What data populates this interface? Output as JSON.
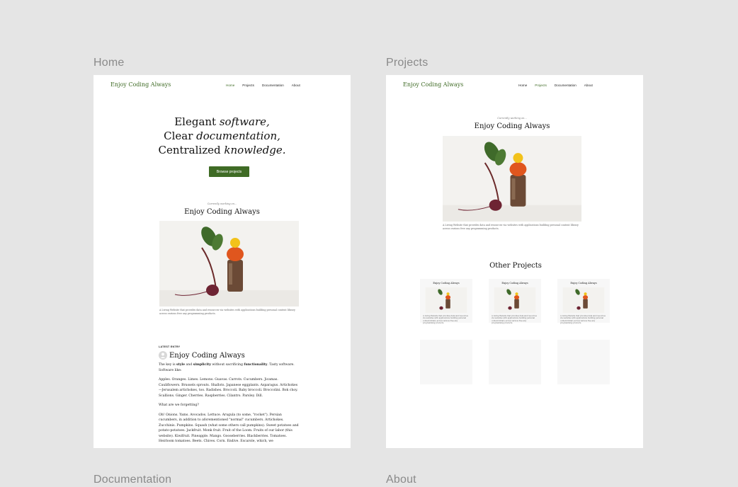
{
  "frames": {
    "home": {
      "label": "Home"
    },
    "projects": {
      "label": "Projects"
    },
    "documentation": {
      "label": "Documentation"
    },
    "about": {
      "label": "About"
    }
  },
  "site": {
    "logo": "Enjoy Coding Always",
    "nav": [
      "Home",
      "Projects",
      "Documentation",
      "About"
    ],
    "accent": "#3f6b25"
  },
  "home": {
    "hero_line1_a": "Elegant ",
    "hero_line1_b": "software,",
    "hero_line2_a": "Clear ",
    "hero_line2_b": "documentation,",
    "hero_line3_a": "Centralized ",
    "hero_line3_b": "knowledge.",
    "cta": "Browse projects",
    "featured_kicker": "Currently working on...",
    "featured_title": "Enjoy Coding Always",
    "featured_caption": "A Living Website that provides data and resources via websites with applications building personal content library across various free any programming products.",
    "latest_label": "LATEST ENTRY",
    "entry_title": "Enjoy Coding Always",
    "entry_p1_a": "The key is ",
    "entry_p1_b": "style",
    "entry_p1_c": " and ",
    "entry_p1_d": "simplicity",
    "entry_p1_e": " without sacrificing ",
    "entry_p1_f": "functionality",
    "entry_p1_g": ". Tasty software. Software like:",
    "entry_p2": "Apples. Oranges. Limes. Lemons. Guavas. Carrots. Cucumbers. Jicamas. Cauliflowers. Brussels sprouts. Shallots. Japanese eggplants. Asparagus. Artichokes—Jerusalem artichokes, too. Radishes. Broccoli. Baby broccoli. Broccolini. Bok choy. Scallions. Ginger. Cherries. Raspberries. Cilantro. Parsley. Dill.",
    "entry_p3": "What are we forgetting?",
    "entry_p4": "Oh! Onions. Yams. Avocados. Lettuce. Arugula (to some, \"rocket\"). Persian cucumbers, in addition to aforementioned \"normal\" cucumbers. Artichokes. Zucchinis. Pumpkins. Squash (what some others call pumpkins). Sweet potatoes and potato-potatoes. Jackfruit. Monk fruit. Fruit of the Loom. Fruits of our labor (this website). Kiwifruit. Pineapple. Mango. Gooseberries. Blackberries. Tomatoes. Heirloom tomatoes. Beets. Chives. Corn. Endive. Escarole, which, we"
  },
  "projects": {
    "kicker": "Currently working on...",
    "title": "Enjoy Coding Always",
    "caption": "A Living Website that provides data and resources via websites with applications building personal content library across various free any programming products.",
    "other_title": "Other Projects",
    "cards": [
      {
        "title": "Enjoy Coding Always",
        "caption": "A Living Website that provides data and resources via websites with applications building personal content library across various free any programming products."
      },
      {
        "title": "Enjoy Coding Always",
        "caption": "A Living Website that provides data and resources via websites with applications building personal content library across various free any programming products."
      },
      {
        "title": "Enjoy Coding Always",
        "caption": "A Living Website that provides data and resources via websites with applications building personal content library across various free any programming products."
      }
    ]
  },
  "icons": {
    "avatar": "user-avatar-icon",
    "hero_image": "vegetables-still-life"
  }
}
